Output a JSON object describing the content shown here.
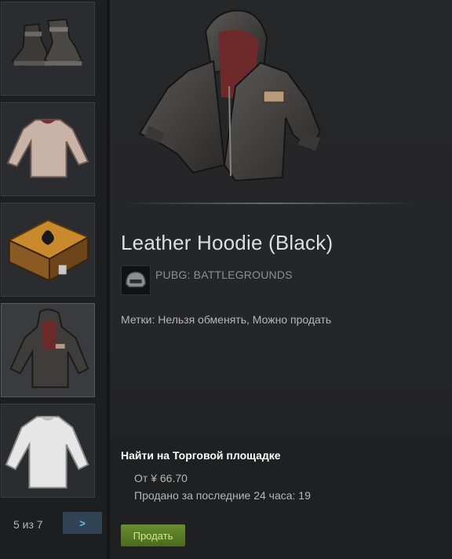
{
  "inventory": {
    "thumbnails": [
      {
        "name": "boots",
        "active": false
      },
      {
        "name": "long-sleeve-shirt",
        "active": false
      },
      {
        "name": "loot-crate",
        "active": false
      },
      {
        "name": "leather-hoodie",
        "active": true
      },
      {
        "name": "white-shirt",
        "active": false
      }
    ],
    "pager": {
      "text": "5 из 7",
      "next_label": ">"
    }
  },
  "item": {
    "title": "Leather Hoodie (Black)",
    "game_name": "PUBG: BATTLEGROUNDS",
    "tags": "Метки: Нельзя обменять, Можно продать"
  },
  "market": {
    "title": "Найти на Торговой площадке",
    "price": "От ¥ 66.70",
    "sold": "Продано за последние 24 часа: 19",
    "sell_label": "Продать"
  },
  "colors": {
    "accent_blue": "#66c0f4",
    "sell_green": "#6a8e2f"
  }
}
